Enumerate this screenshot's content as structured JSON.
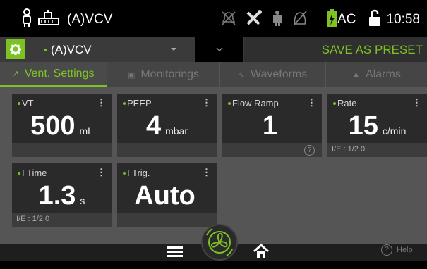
{
  "status_bar": {
    "mode": "(A)VCV",
    "power_label": "AC",
    "time": "10:58",
    "icons": [
      "patient-icon",
      "circuit-icon",
      "alarm-silence-icon",
      "tools-icon",
      "lungs-icon",
      "o2-sensor-icon",
      "battery-charging-icon",
      "lock-open-icon"
    ]
  },
  "mode_bar": {
    "selected_mode": "(A)VCV",
    "preset_label": "SAVE AS PRESET"
  },
  "tabs": [
    {
      "label": "Vent. Settings",
      "icon": "wrench-icon",
      "active": true
    },
    {
      "label": "Monitorings",
      "icon": "monitor-icon",
      "active": false
    },
    {
      "label": "Waveforms",
      "icon": "waveform-icon",
      "active": false
    },
    {
      "label": "Alarms",
      "icon": "bell-icon",
      "active": false
    }
  ],
  "settings": [
    {
      "label": "VT",
      "value": "500",
      "unit": "mL",
      "footer": ""
    },
    {
      "label": "PEEP",
      "value": "4",
      "unit": "mbar",
      "footer": ""
    },
    {
      "label": "Flow Ramp",
      "value": "1",
      "unit": "",
      "footer": ""
    },
    {
      "label": "Rate",
      "value": "15",
      "unit": "c/min",
      "footer": "I/E : 1/2.0"
    },
    {
      "label": "I Time",
      "value": "1.3",
      "unit": "s",
      "footer": "I/E : 1/2.0"
    },
    {
      "label": "I Trig.",
      "value": "Auto",
      "unit": "",
      "footer": ""
    }
  ],
  "bottom_bar": {
    "help_label": "Help"
  },
  "colors": {
    "accent": "#7dc224",
    "tile_bg": "#2a2a2a",
    "panel_bg": "#555555"
  }
}
